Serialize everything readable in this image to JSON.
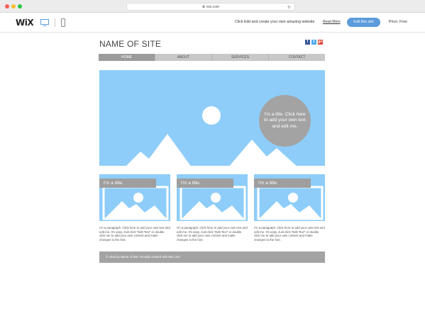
{
  "browser": {
    "url": "wix.com"
  },
  "topbar": {
    "logo": "WiX",
    "promo_text": "Click Edit and create your own amazing website",
    "read_more": "Read More",
    "edit_button": "Edit this site",
    "price": "Price: Free",
    "icons": [
      "desktop-icon",
      "mobile-icon"
    ]
  },
  "site": {
    "name": "NAME OF SITE",
    "social": [
      "f",
      "t",
      "g+"
    ],
    "nav": [
      "HOME",
      "ABOUT",
      "SERVICES",
      "CONTACT"
    ],
    "active_nav": "HOME",
    "hero_text": "I'm a title. Click here to add your own text and edit me.",
    "cards": [
      {
        "title": "I'm a title.",
        "paragraph": "I'm a paragraph. Click here to add your own text and edit me. It's easy. Just click \"Edit Text\" or double click me to add your own content and make changes to the font."
      },
      {
        "title": "I'm a title.",
        "paragraph": "I'm a paragraph. Click here to add your own text and edit me. It's easy. Just click \"Edit Text\" or double click me to add your own content and make changes to the font."
      },
      {
        "title": "I'm a title.",
        "paragraph": "I'm a paragraph. Click here to add your own text and edit me. It's easy. Just click \"Edit Text\" or double click me to add your own content and make changes to the font."
      }
    ],
    "footer": "© 2023 by Name of Site. Proudly created with Wix.com"
  },
  "colors": {
    "placeholder_blue": "#8ecdf9",
    "button_blue": "#5b9bdb",
    "gray": "#a3a3a3"
  }
}
